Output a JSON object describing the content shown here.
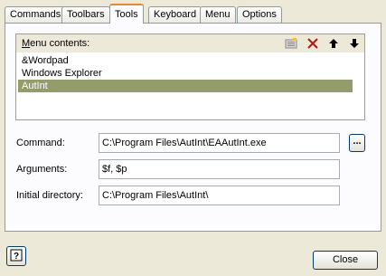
{
  "tabs": [
    {
      "label": "Commands"
    },
    {
      "label": "Toolbars"
    },
    {
      "label": "Tools"
    },
    {
      "label": "Keyboard"
    },
    {
      "label": "Menu"
    },
    {
      "label": "Options"
    }
  ],
  "active_tab": "Tools",
  "menu_contents": {
    "title_mnemonic": "M",
    "title_rest": "enu contents:",
    "items": [
      {
        "label": "&Wordpad"
      },
      {
        "label": "Windows Explorer"
      },
      {
        "label": "AutInt",
        "selected": true
      }
    ],
    "toolbar_icons": [
      "new-icon",
      "delete-icon",
      "move-up-icon",
      "move-down-icon"
    ]
  },
  "command": {
    "label": "Command:",
    "value": "C:\\Program Files\\AutInt\\EAAutInt.exe",
    "browse_label": "..."
  },
  "arguments": {
    "label": "Arguments:",
    "value": "$f, $p"
  },
  "initial_directory": {
    "label": "Initial directory:",
    "value": "C:\\Program Files\\AutInt\\"
  },
  "buttons": {
    "close": "Close",
    "help_icon": "help-icon"
  },
  "colors": {
    "selection": "#939d6c",
    "tab_highlight": "#e68b2c",
    "background": "#ece9d8"
  }
}
